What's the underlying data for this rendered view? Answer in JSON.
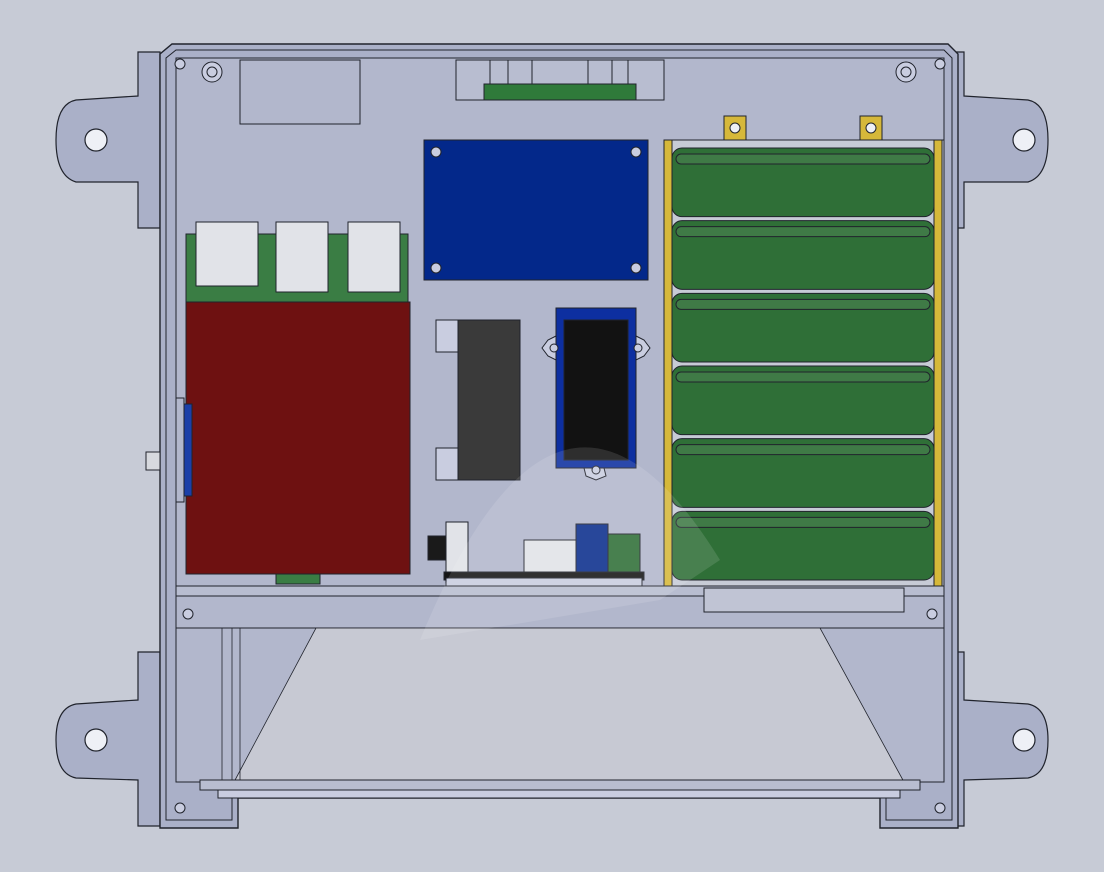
{
  "colors": {
    "background": "#c7cbd6",
    "enclosure": "#aab0c8",
    "enclosure_outline": "#20232c",
    "inner_floor": "#b2b7cc",
    "raspberry_pi_board": "#6e1111",
    "raspberry_pi_pcb": "#3a7d44",
    "usb_port": "#e1e3e8",
    "controller_board": "#03288a",
    "battery_cell": "#2f6f37",
    "battery_holder": "#d6b83a",
    "relay_body": "#3a3a3a",
    "display_bezel": "#0d2fa0",
    "display_screen": "#121212",
    "terminal_blue": "#0b2e8c",
    "terminal_green": "#2f6f37",
    "transparent_cover": "#d8d8d8"
  },
  "battery": {
    "cell_count": 6
  },
  "icons": [
    "mounting-hole-icon",
    "screw-icon",
    "battery-terminal-icon"
  ]
}
